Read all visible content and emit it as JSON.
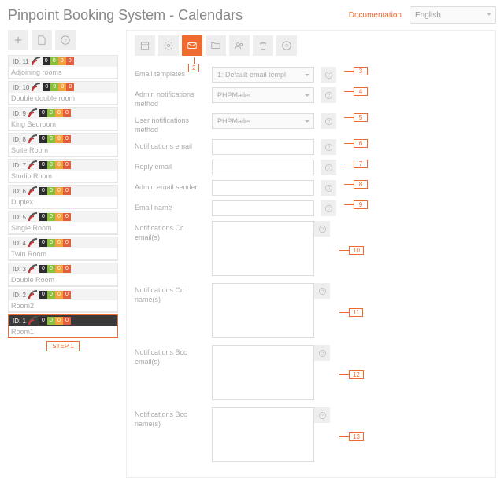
{
  "header": {
    "title": "Pinpoint Booking System - Calendars",
    "doc_link": "Documentation",
    "language": "English"
  },
  "left_toolbar": [
    "plus-icon",
    "export-icon",
    "help-icon"
  ],
  "calendars": [
    {
      "id": "ID: 11",
      "name": "Adjoining rooms",
      "pills": [
        "0",
        "0",
        "0",
        "0"
      ],
      "selected": false
    },
    {
      "id": "ID: 10",
      "name": "Double double room",
      "pills": [
        "0",
        "0",
        "0",
        "0"
      ],
      "selected": false
    },
    {
      "id": "ID: 9",
      "name": "King Bedroom",
      "pills": [
        "0",
        "0",
        "0",
        "0"
      ],
      "selected": false
    },
    {
      "id": "ID: 8",
      "name": "Suite Room",
      "pills": [
        "0",
        "0",
        "0",
        "0"
      ],
      "selected": false
    },
    {
      "id": "ID: 7",
      "name": "Studio Room",
      "pills": [
        "0",
        "0",
        "0",
        "0"
      ],
      "selected": false
    },
    {
      "id": "ID: 6",
      "name": "Duplex",
      "pills": [
        "0",
        "0",
        "0",
        "0"
      ],
      "selected": false
    },
    {
      "id": "ID: 5",
      "name": "Single Room",
      "pills": [
        "0",
        "0",
        "0",
        "0"
      ],
      "selected": false
    },
    {
      "id": "ID: 4",
      "name": "Twin Room",
      "pills": [
        "0",
        "0",
        "0",
        "0"
      ],
      "selected": false
    },
    {
      "id": "ID: 3",
      "name": "Double Room",
      "pills": [
        "0",
        "0",
        "0",
        "0"
      ],
      "selected": false
    },
    {
      "id": "ID: 2",
      "name": "Room2",
      "pills": [
        "0",
        "0",
        "0",
        "0"
      ],
      "selected": false
    },
    {
      "id": "ID: 1",
      "name": "Room1",
      "pills": [
        "0",
        "0",
        "0",
        "0"
      ],
      "selected": true
    }
  ],
  "step1_label": "STEP 1",
  "main_toolbar": [
    {
      "icon": "calendar-icon",
      "active": false
    },
    {
      "icon": "gear-icon",
      "active": false
    },
    {
      "icon": "mail-icon",
      "active": true
    },
    {
      "icon": "folder-icon",
      "active": false
    },
    {
      "icon": "users-icon",
      "active": false
    },
    {
      "icon": "trash-icon",
      "active": false
    },
    {
      "icon": "help-icon",
      "active": false
    }
  ],
  "callouts": {
    "c2": "2",
    "c3": "3",
    "c4": "4",
    "c5": "5",
    "c6": "6",
    "c7": "7",
    "c8": "8",
    "c9": "9",
    "c10": "10",
    "c11": "11",
    "c12": "12",
    "c13": "13"
  },
  "fields": {
    "email_templates": {
      "label": "Email templates",
      "value": "1: Default email templ",
      "type": "select",
      "callout": "c3"
    },
    "admin_notify": {
      "label": "Admin notifications method",
      "value": "PHPMailer",
      "type": "select",
      "callout": "c4"
    },
    "user_notify": {
      "label": "User notifications method",
      "value": "PHPMailer",
      "type": "select",
      "callout": "c5"
    },
    "notify_email": {
      "label": "Notifications email",
      "value": "",
      "type": "input",
      "callout": "c6"
    },
    "reply_email": {
      "label": "Reply email",
      "value": "",
      "type": "input",
      "callout": "c7"
    },
    "admin_sender": {
      "label": "Admin email sender",
      "value": "",
      "type": "input",
      "callout": "c8"
    },
    "email_name": {
      "label": "Email name",
      "value": "",
      "type": "input",
      "callout": "c9"
    },
    "cc_emails": {
      "label": "Notifications Cc email(s)",
      "value": "",
      "type": "textarea",
      "callout": "c10"
    },
    "cc_names": {
      "label": "Notifications Cc name(s)",
      "value": "",
      "type": "textarea",
      "callout": "c11"
    },
    "bcc_emails": {
      "label": "Notifications Bcc email(s)",
      "value": "",
      "type": "textarea",
      "callout": "c12"
    },
    "bcc_names": {
      "label": "Notifications Bcc name(s)",
      "value": "",
      "type": "textarea",
      "callout": "c13"
    }
  }
}
